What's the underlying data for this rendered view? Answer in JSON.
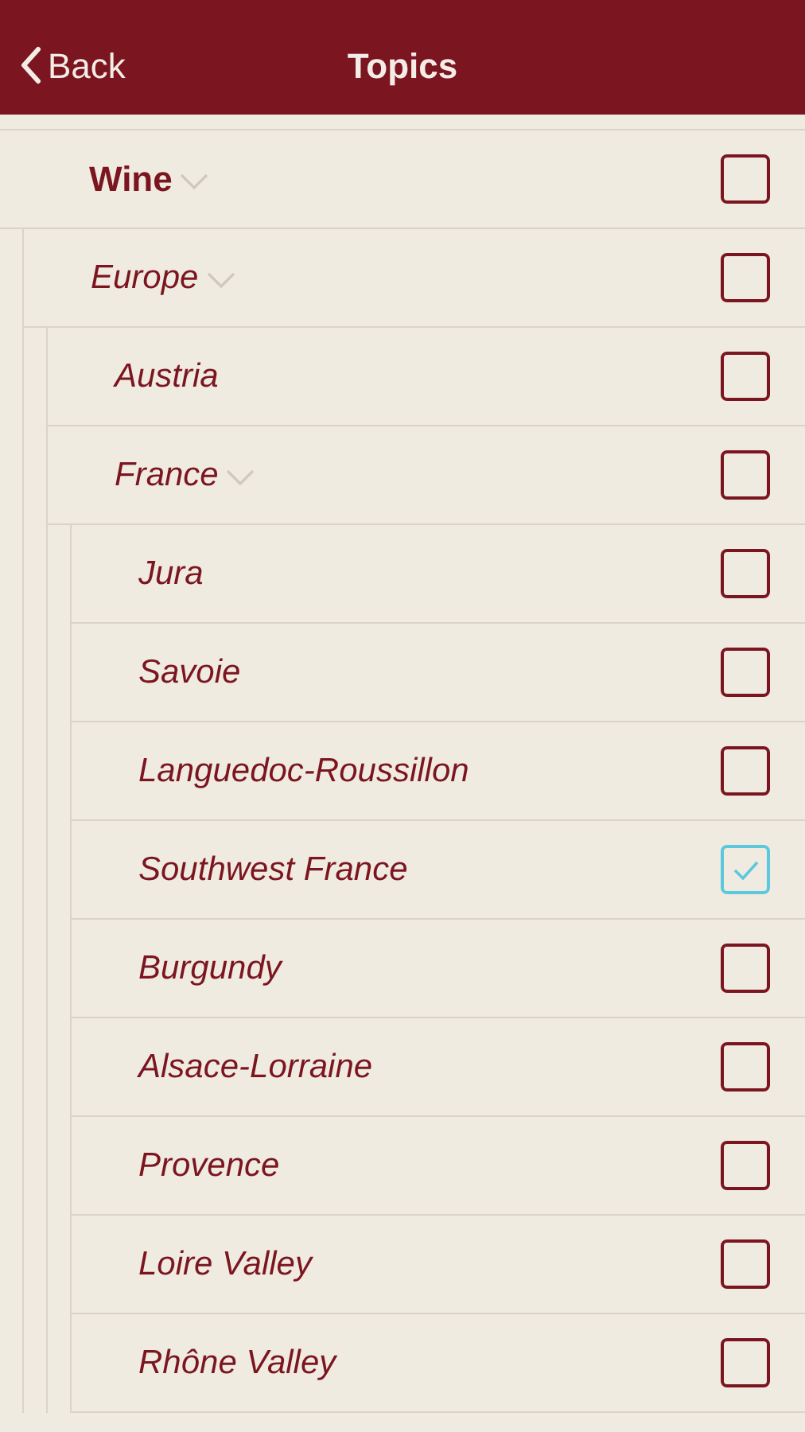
{
  "nav_bar": {
    "back_label": "Back",
    "title": "Topics"
  },
  "tree": [
    {
      "label": "Wine",
      "checked": false,
      "expanded": true,
      "children": [
        {
          "label": "Europe",
          "checked": false,
          "expanded": true,
          "children": [
            {
              "label": "Austria",
              "checked": false
            },
            {
              "label": "France",
              "checked": false,
              "expanded": true,
              "children": [
                {
                  "label": "Jura",
                  "checked": false
                },
                {
                  "label": "Savoie",
                  "checked": false
                },
                {
                  "label": "Languedoc-Roussillon",
                  "checked": false
                },
                {
                  "label": "Southwest France",
                  "checked": true
                },
                {
                  "label": "Burgundy",
                  "checked": false
                },
                {
                  "label": "Alsace-Lorraine",
                  "checked": false
                },
                {
                  "label": "Provence",
                  "checked": false
                },
                {
                  "label": "Loire Valley",
                  "checked": false
                },
                {
                  "label": "Rhône Valley",
                  "checked": false
                }
              ]
            }
          ]
        }
      ]
    }
  ]
}
